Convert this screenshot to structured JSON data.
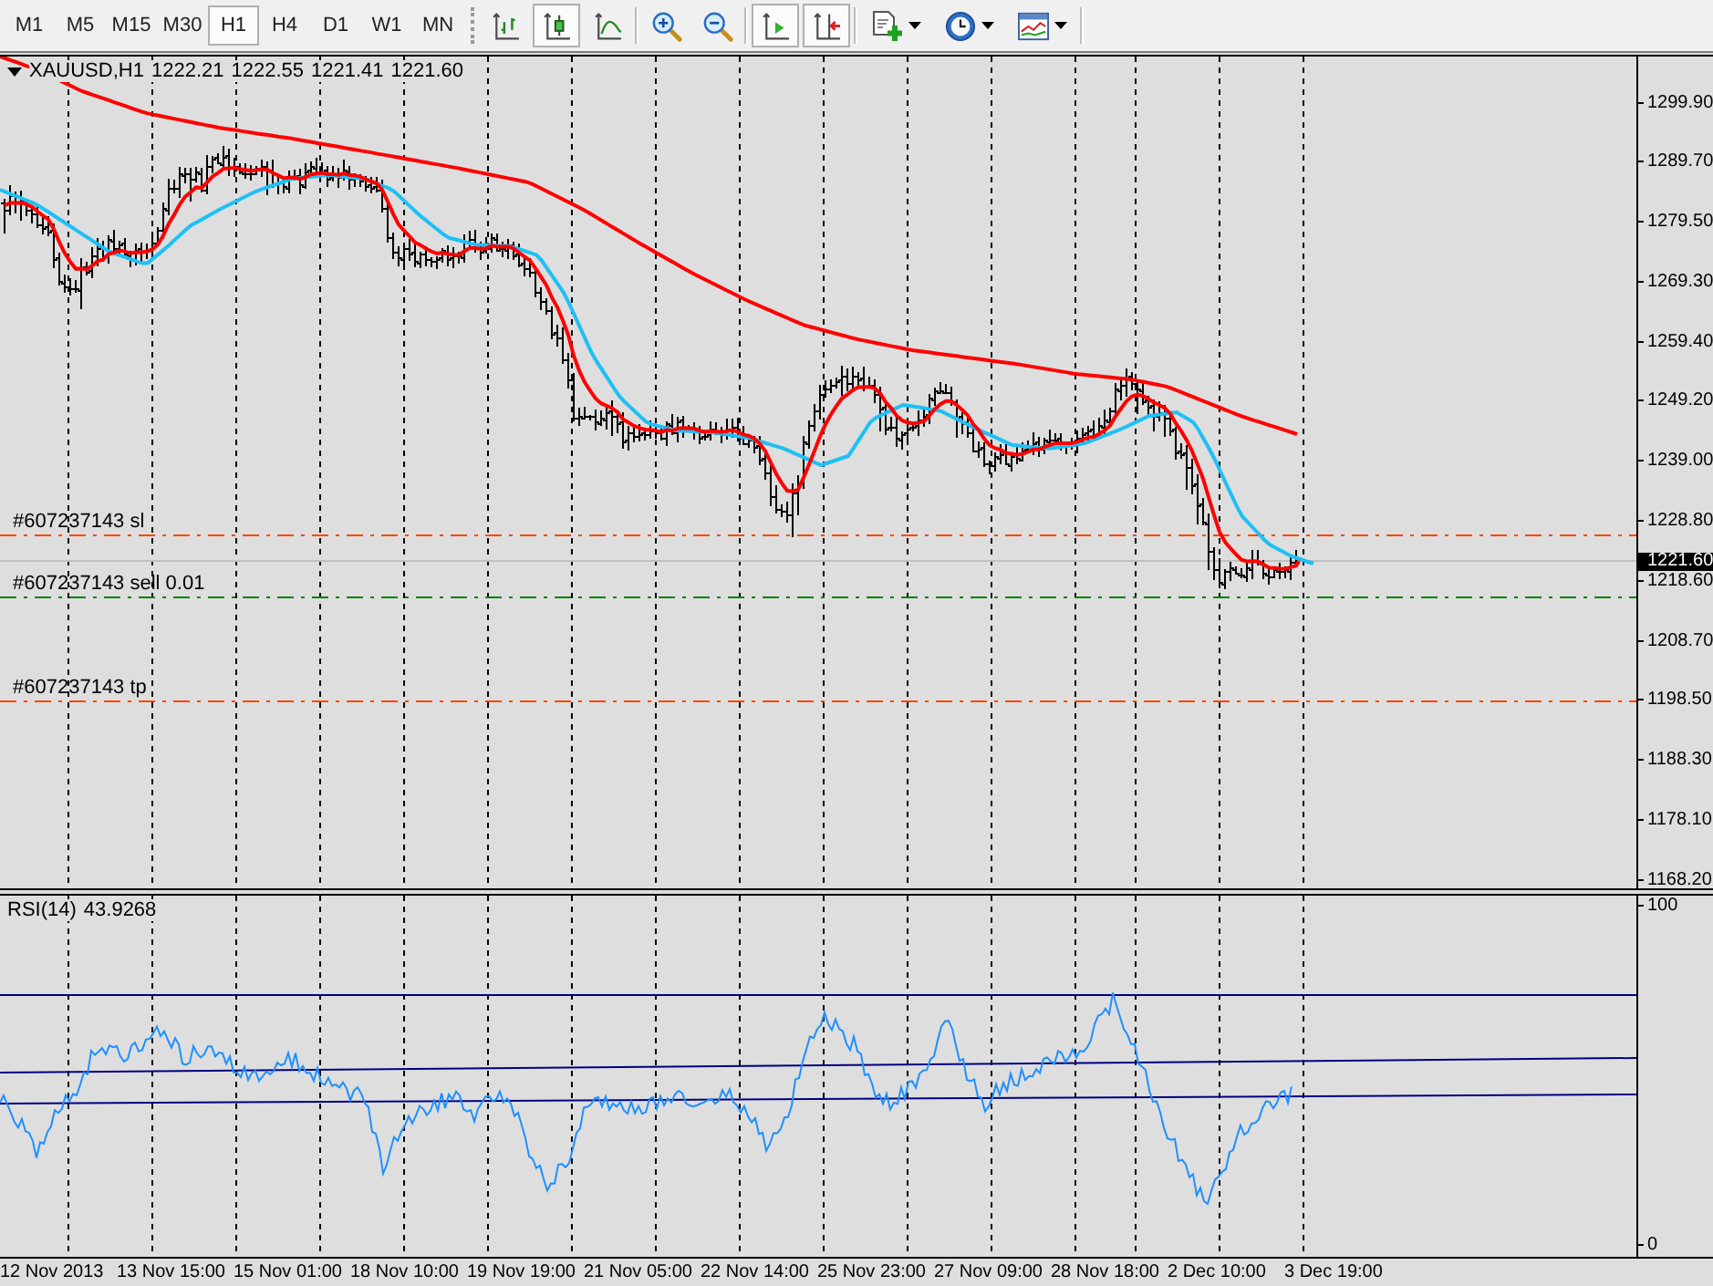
{
  "toolbar": {
    "timeframes": [
      {
        "label": "M1",
        "selected": false
      },
      {
        "label": "M5",
        "selected": false
      },
      {
        "label": "M15",
        "selected": false
      },
      {
        "label": "M30",
        "selected": false
      },
      {
        "label": "H1",
        "selected": true
      },
      {
        "label": "H4",
        "selected": false
      },
      {
        "label": "D1",
        "selected": false
      },
      {
        "label": "W1",
        "selected": false
      },
      {
        "label": "MN",
        "selected": false
      }
    ],
    "chart_types": [
      {
        "selected": false
      },
      {
        "selected": true
      },
      {
        "selected": false
      }
    ],
    "toggles": [
      {
        "on": true
      },
      {
        "on": true
      }
    ]
  },
  "chart": {
    "header": {
      "symbol": "XAUUSD,H1",
      "ohlc": [
        "1222.21",
        "1222.55",
        "1221.41",
        "1221.60"
      ]
    },
    "orders": [
      {
        "kind": "stop_loss",
        "label": "#607237143 sl"
      },
      {
        "kind": "entry",
        "label": "#607237143 sell 0.01"
      },
      {
        "kind": "take_profit",
        "label": "#607237143 tp"
      }
    ],
    "price_axis": [
      "1299.90",
      "1289.70",
      "1279.50",
      "1269.30",
      "1259.40",
      "1249.20",
      "1239.00",
      "1228.80",
      "1218.60",
      "1208.70",
      "1198.50",
      "1188.30",
      "1178.10",
      "1168.20"
    ],
    "current_price": "1221.60"
  },
  "indicator": {
    "name": "RSI(14)",
    "value": "43.9268",
    "axis": [
      "100",
      "0"
    ]
  },
  "time_axis": [
    "12 Nov 2013",
    "13 Nov 15:00",
    "15 Nov 01:00",
    "18 Nov 10:00",
    "19 Nov 19:00",
    "21 Nov 05:00",
    "22 Nov 14:00",
    "25 Nov 23:00",
    "27 Nov 09:00",
    "28 Nov 18:00",
    "2 Dec 10:00",
    "3 Dec 19:00"
  ]
}
